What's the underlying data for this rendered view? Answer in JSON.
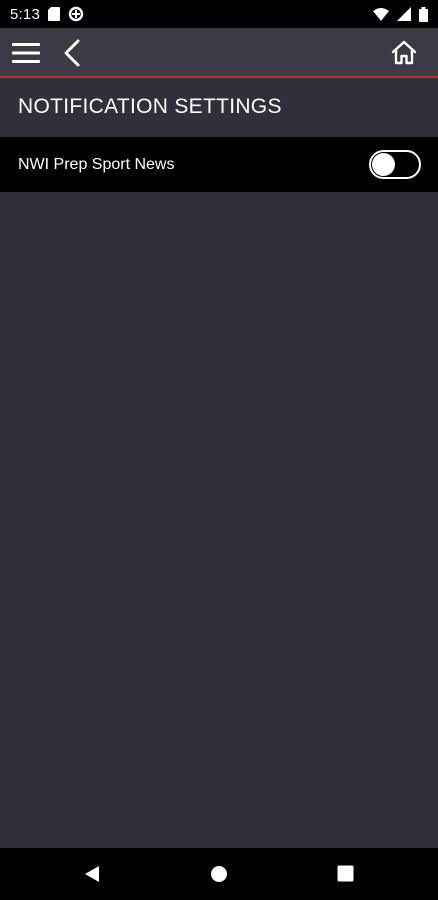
{
  "status_bar": {
    "time": "5:13",
    "icons_left": [
      "sd-card-icon",
      "data-saver-icon"
    ],
    "icons_right": [
      "wifi-icon",
      "signal-icon",
      "battery-icon"
    ]
  },
  "app_bar": {
    "menu_icon": "hamburger-menu-icon",
    "back_icon": "chevron-left-icon",
    "home_icon": "home-icon",
    "accent_color": "#b2312a"
  },
  "page": {
    "title": "NOTIFICATION SETTINGS"
  },
  "settings": [
    {
      "label": "NWI Prep Sport News",
      "enabled": false
    }
  ],
  "nav_bar": {
    "icons": [
      "triangle-back-icon",
      "circle-home-icon",
      "square-recents-icon"
    ]
  },
  "colors": {
    "background": "#2f3039",
    "app_bar": "#3a3b44",
    "row_background": "#000000",
    "text": "#ffffff"
  }
}
